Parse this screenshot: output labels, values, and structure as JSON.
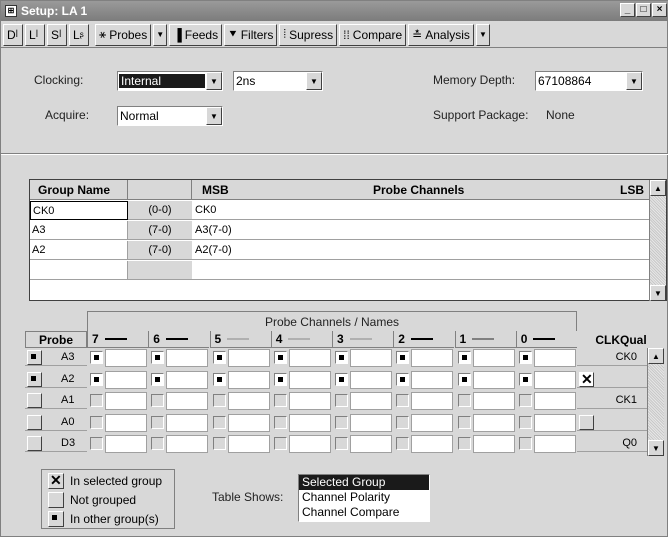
{
  "window": {
    "title": "Setup: LA 1",
    "title_icon": "setup-window-icon",
    "controls": [
      "_",
      "□",
      "×"
    ]
  },
  "toolbar": {
    "icon_buttons": [
      "D",
      "L",
      "S",
      "L"
    ],
    "probes": "Probes",
    "feeds": "Feeds",
    "filters": "Filters",
    "supress": "Supress",
    "compare": "Compare",
    "analysis": "Analysis"
  },
  "settings": {
    "clocking_label": "Clocking:",
    "clocking_value": "Internal",
    "clocking_rate": "2ns",
    "acquire_label": "Acquire:",
    "acquire_value": "Normal",
    "memory_depth_label": "Memory Depth:",
    "memory_depth_value": "67108864",
    "support_package_label": "Support Package:",
    "support_package_value": "None"
  },
  "group_table": {
    "headers": {
      "group_name": "Group Name",
      "msb": "MSB",
      "probe_channels": "Probe Channels",
      "lsb": "LSB"
    },
    "rows": [
      {
        "name": "CK0",
        "range": "(0-0)",
        "channels": "CK0"
      },
      {
        "name": "A3",
        "range": "(7-0)",
        "channels": "A3(7-0)"
      },
      {
        "name": "A2",
        "range": "(7-0)",
        "channels": "A2(7-0)"
      }
    ]
  },
  "probe_table": {
    "title": "Probe Channels / Names",
    "probe_header": "Probe",
    "clkqual_header": "CLKQual",
    "channels": [
      "7",
      "6",
      "5",
      "4",
      "3",
      "2",
      "1",
      "0"
    ],
    "rows": [
      {
        "probe": "A3",
        "marks": "dot",
        "clk_mark": "",
        "clk": "CK0"
      },
      {
        "probe": "A2",
        "marks": "dot",
        "clk_mark": "x",
        "clk": ""
      },
      {
        "probe": "A1",
        "marks": "empty",
        "clk_mark": "",
        "clk": "CK1"
      },
      {
        "probe": "A0",
        "marks": "empty",
        "clk_mark": "box",
        "clk": ""
      },
      {
        "probe": "D3",
        "marks": "empty",
        "clk_mark": "",
        "clk": "Q0"
      }
    ]
  },
  "legend": {
    "selected": "In selected group",
    "not_grouped": "Not grouped",
    "other": "In other group(s)"
  },
  "table_shows": {
    "label": "Table Shows:",
    "options": [
      "Selected Group",
      "Channel Polarity",
      "Channel Compare"
    ],
    "selected": "Selected Group"
  }
}
